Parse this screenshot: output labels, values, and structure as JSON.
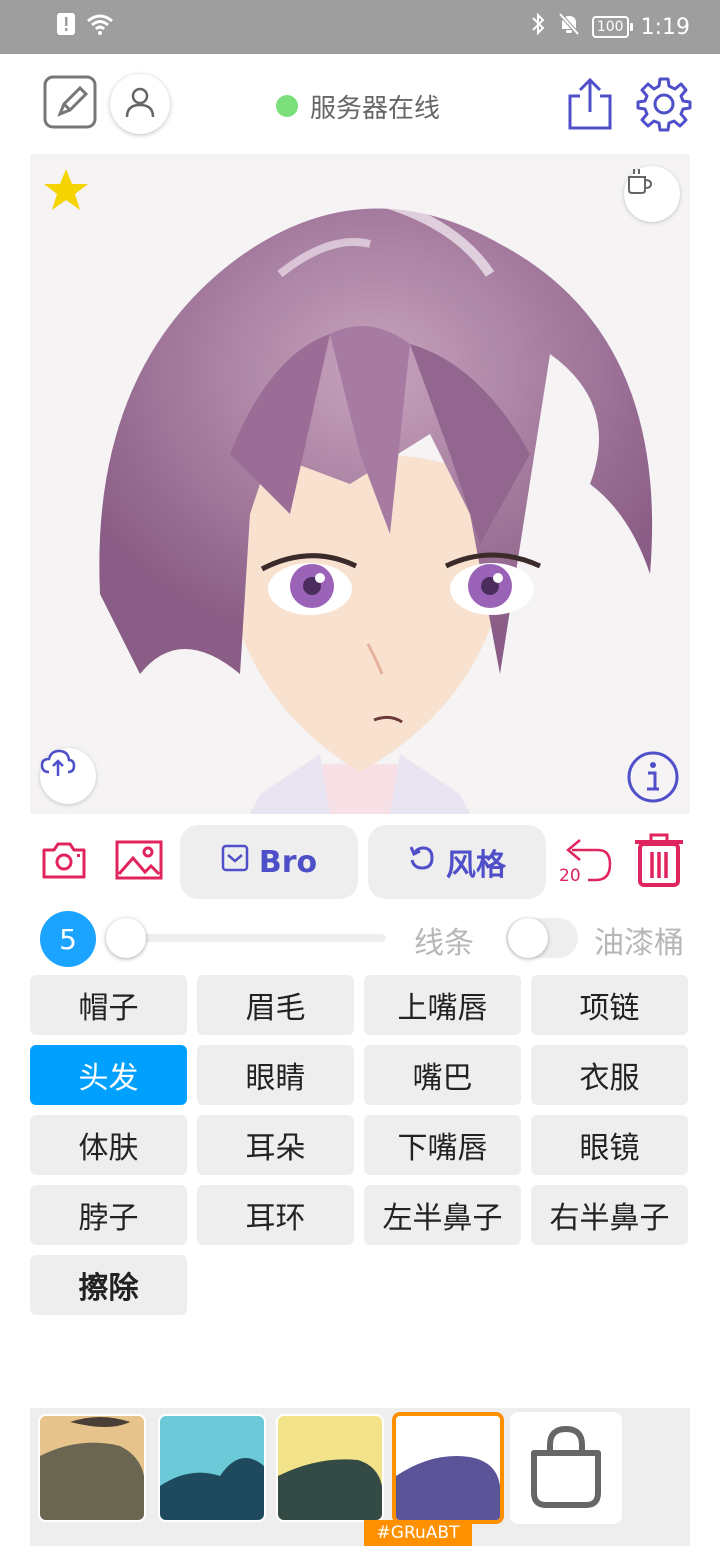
{
  "status_bar": {
    "time": "1:19",
    "battery": "100",
    "icons": [
      "alert-icon",
      "wifi-icon",
      "bluetooth-icon",
      "mute-icon",
      "battery-icon"
    ]
  },
  "header": {
    "server_status": "服务器在线",
    "status_color": "#7be07b",
    "icons": [
      "edit-icon",
      "user-icon",
      "share-icon",
      "settings-icon"
    ]
  },
  "canvas": {
    "icons": [
      "star-icon",
      "coffee-icon",
      "upload-cloud-icon",
      "info-icon"
    ]
  },
  "toolbar": {
    "bro_label": "Bro",
    "style_label": "风格",
    "undo_count": "20",
    "icons": [
      "camera-icon",
      "gallery-icon",
      "checkbox-icon",
      "refresh-icon",
      "undo-icon",
      "trash-icon"
    ],
    "accent": "#e0245e",
    "primary": "#4f4fc9"
  },
  "brush": {
    "size": "5",
    "slider_level": 0.0,
    "line_label": "线条",
    "bucket_label": "油漆桶",
    "bucket_on": false
  },
  "parts": [
    {
      "label": "帽子"
    },
    {
      "label": "眉毛"
    },
    {
      "label": "上嘴唇"
    },
    {
      "label": "项链"
    },
    {
      "label": "头发",
      "active": true
    },
    {
      "label": "眼睛"
    },
    {
      "label": "嘴巴"
    },
    {
      "label": "衣服"
    },
    {
      "label": "体肤"
    },
    {
      "label": "耳朵"
    },
    {
      "label": "下嘴唇"
    },
    {
      "label": "眼镜"
    },
    {
      "label": "脖子"
    },
    {
      "label": "耳环"
    },
    {
      "label": "左半鼻子"
    },
    {
      "label": "右半鼻子"
    },
    {
      "label": "擦除",
      "bold": true
    }
  ],
  "styles_tray": {
    "selected_tag": "#GRuABT",
    "thumb_colors": [
      "#e8c690",
      "#6ccad8",
      "#f2e38a",
      "#ffffff"
    ],
    "icons": [
      "shopping-bag-icon"
    ]
  }
}
